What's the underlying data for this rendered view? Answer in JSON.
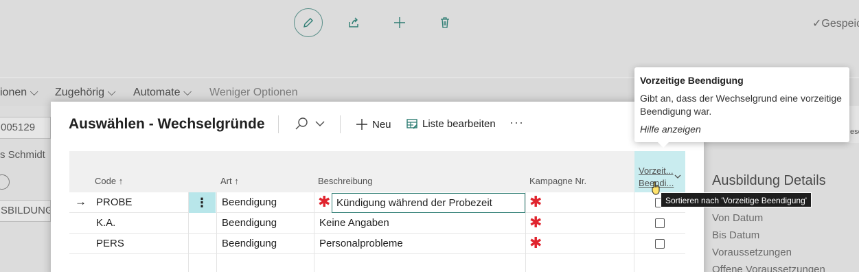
{
  "background": {
    "saved_label": "✓Gespeic",
    "menu": [
      "ionen",
      "Zugehörig",
      "Automate",
      "Weniger Optionen"
    ],
    "fields": [
      "005129",
      "s Schmidt",
      "SBILDUNG"
    ],
    "details_title": "Ausbildung Details",
    "details_items": [
      "Von Datum",
      "Bis Datum",
      "Voraussetzungen",
      "Offene Voraussetzungen"
    ],
    "right_cut_text": "esch"
  },
  "dialog": {
    "title": "Auswählen - Wechselgründe",
    "new_label": "Neu",
    "edit_list_label": "Liste bearbeiten",
    "more_label": "···"
  },
  "grid": {
    "headers": {
      "code": "Code",
      "art": "Art",
      "beschreibung": "Beschreibung",
      "kampagne": "Kampagne Nr.",
      "vorzeitig_line1": "Vorzeit...",
      "vorzeitig_line2": "Beendi..."
    },
    "rows": [
      {
        "code": "PROBE",
        "art": "Beendigung",
        "beschreibung": "Kündigung während der Probezeit"
      },
      {
        "code": "K.A.",
        "art": "Beendigung",
        "beschreibung": "Keine Angaben"
      },
      {
        "code": "PERS",
        "art": "Beendigung",
        "beschreibung": "Personalprobleme"
      }
    ]
  },
  "tooltip": {
    "title": "Vorzeitige Beendigung",
    "body": "Gibt an, dass der Wechselgrund eine vorzeitige Beendigung war.",
    "link": "Hilfe anzeigen"
  },
  "sort_tip": "Sortieren nach 'Vorzeitige Beendigung'",
  "colors": {
    "accent": "#2e7d73",
    "required": "#e0242e",
    "header_highlight": "#c9ecef"
  }
}
